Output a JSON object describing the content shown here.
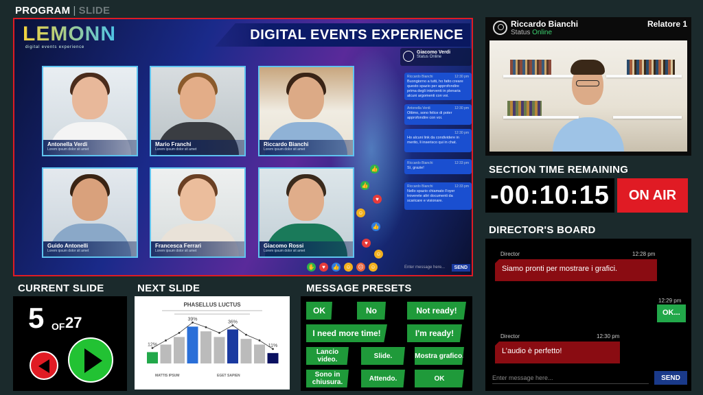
{
  "header": {
    "program": "PROGRAM",
    "sep": "|",
    "slide": "SLIDE"
  },
  "stage": {
    "logo": "LEMONN",
    "logo_tag": "digital events experience",
    "banner": "DIGITAL EVENTS EXPERIENCE",
    "participants": [
      {
        "name": "Antonella Verdi",
        "sub": "Lorem ipsum dolor sit amet"
      },
      {
        "name": "Mario Franchi",
        "sub": "Lorem ipsum dolor sit amet"
      },
      {
        "name": "Riccardo Bianchi",
        "sub": "Lorem ipsum dolor sit amet"
      },
      {
        "name": "Guido Antonelli",
        "sub": "Lorem ipsum dolor sit amet"
      },
      {
        "name": "Francesca Ferrari",
        "sub": "Lorem ipsum dolor sit amet"
      },
      {
        "name": "Giacomo Rossi",
        "sub": "Lorem ipsum dolor sit amet"
      }
    ],
    "chat": {
      "user": "Giacomo Verdi",
      "status": "Status Online",
      "messages": [
        {
          "from": "Riccardo Bianchi",
          "time": "12:30 pm",
          "text": "Buongiorno a tutti, ho fatto creare questo spazio per approfondire prima degli interventi in plenaria alcuni argomenti con voi."
        },
        {
          "from": "Antonella Verdi",
          "time": "12:30 pm",
          "text": "Ottimo, sono felice di poter approfondire con voi."
        },
        {
          "from": "",
          "time": "12:30 pm",
          "text": "Ho alcuni link da condividere in merito, li inserisco qui in chat."
        },
        {
          "from": "Riccardo Bianchi",
          "time": "12:33 pm",
          "text": "Sì, grazie!"
        },
        {
          "from": "Riccardo Bianchi",
          "time": "12:33 pm",
          "text": "Nello spazio chiamato Foyer troverete altri documenti da scaricare e visionare."
        }
      ],
      "input_placeholder": "Enter message here...",
      "send": "SEND"
    }
  },
  "speaker": {
    "name": "Riccardo Bianchi",
    "status_prefix": "Status",
    "status": "Online",
    "role": "Relatore 1"
  },
  "timer": {
    "label": "SECTION TIME REMAINING",
    "value": "-00:10:15",
    "on_air": "ON AIR"
  },
  "board": {
    "label": "DIRECTOR'S BOARD",
    "messages": [
      {
        "from": "Director",
        "time": "12:28 pm",
        "text": "Siamo pronti per mostrare i grafici."
      },
      {
        "from": "",
        "time": "12:29 pm",
        "text": "OK..."
      },
      {
        "from": "Director",
        "time": "12:30 pm",
        "text": "L’audio è perfetto!"
      }
    ],
    "input_placeholder": "Enter message here...",
    "send": "SEND"
  },
  "current_slide": {
    "label": "CURRENT SLIDE",
    "number": "5",
    "of": "OF",
    "total": "27"
  },
  "next_slide": {
    "label": "NEXT SLIDE",
    "title": "PHASELLUS LUCTUS",
    "caption_left": "MATTIS IPSUM",
    "caption_right": "EGET SAPIEN",
    "chart_data": {
      "type": "bar",
      "values": [
        12,
        20,
        28,
        39,
        34,
        28,
        36,
        26,
        20,
        11
      ],
      "labels": [
        "12%",
        "",
        "",
        "39%",
        "",
        "",
        "36%",
        "",
        "",
        "11%"
      ],
      "colors": [
        "#22a84a",
        "#bbbbbb",
        "#bbbbbb",
        "#2a6fd8",
        "#bbbbbb",
        "#bbbbbb",
        "#1a3aa0",
        "#bbbbbb",
        "#bbbbbb",
        "#0a1060"
      ]
    }
  },
  "presets": {
    "label": "MESSAGE PRESETS",
    "items": [
      "OK",
      "No",
      "Not ready!",
      "I need more time!",
      "I'm ready!",
      "Lancio video.",
      "Slide.",
      "Mostra grafico.",
      "Sono in chiusura.",
      "Attendo.",
      "OK"
    ]
  }
}
